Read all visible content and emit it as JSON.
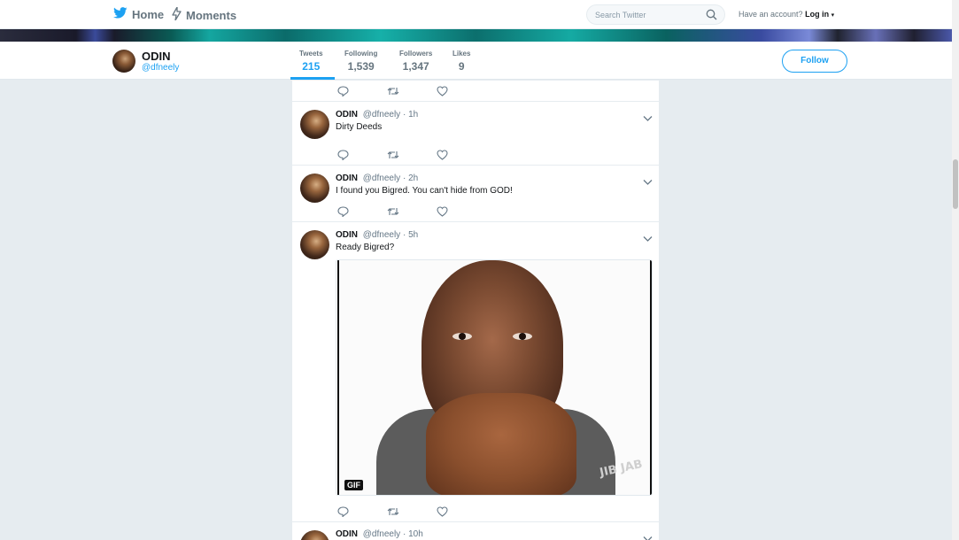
{
  "topnav": {
    "home_label": "Home",
    "moments_label": "Moments",
    "search_placeholder": "Search Twitter",
    "account_prompt": "Have an account?",
    "login_label": "Log in"
  },
  "profile": {
    "name": "ODIN",
    "handle": "@dfneely",
    "follow_label": "Follow",
    "stats": [
      {
        "label": "Tweets",
        "value": "215"
      },
      {
        "label": "Following",
        "value": "1,539"
      },
      {
        "label": "Followers",
        "value": "1,347"
      },
      {
        "label": "Likes",
        "value": "9"
      }
    ]
  },
  "tweets": [
    {
      "name": "ODIN",
      "handle": "@dfneely",
      "time": "· 1h",
      "text": "Dirty Deeds"
    },
    {
      "name": "ODIN",
      "handle": "@dfneely",
      "time": "· 2h",
      "text": "I found you Bigred. You can't hide from GOD!"
    },
    {
      "name": "ODIN",
      "handle": "@dfneely",
      "time": "· 5h",
      "text": "Ready Bigred?",
      "media_badge": "GIF",
      "media_watermark": "JIB JAB"
    },
    {
      "name": "ODIN",
      "handle": "@dfneely",
      "time": "· 10h",
      "text": ""
    }
  ],
  "colors": {
    "accent": "#1da1f2",
    "background": "#e6ecf0",
    "text": "#14171a",
    "muted": "#657786"
  }
}
